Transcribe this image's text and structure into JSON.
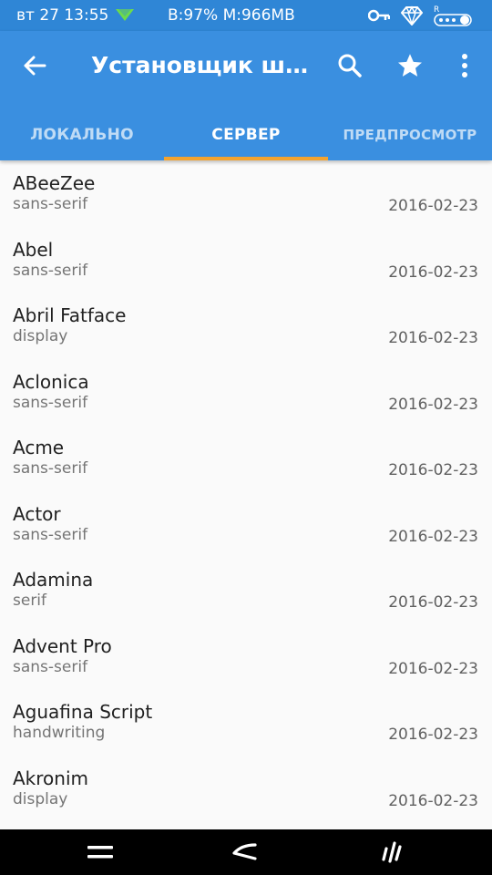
{
  "status_bar": {
    "day_time": "вт 27 13:55",
    "battery_memory": "B:97% M:966MB",
    "icons": [
      "download-arrow-icon",
      "key-icon",
      "diamond-icon",
      "rooted-toggle-icon"
    ]
  },
  "app_bar": {
    "title": "Установщик шрифтов",
    "icons": [
      "back-arrow-icon",
      "search-icon",
      "star-icon",
      "more-vert-icon"
    ]
  },
  "tabs": [
    {
      "label": "ЛОКАЛЬНО",
      "active": false
    },
    {
      "label": "СЕРВЕР",
      "active": true
    },
    {
      "label": "ПРЕДПРОСМОТР",
      "active": false
    }
  ],
  "fonts": [
    {
      "name": "ABeeZee",
      "category": "sans-serif",
      "date": "2016-02-23"
    },
    {
      "name": "Abel",
      "category": "sans-serif",
      "date": "2016-02-23"
    },
    {
      "name": "Abril Fatface",
      "category": "display",
      "date": "2016-02-23"
    },
    {
      "name": "Aclonica",
      "category": "sans-serif",
      "date": "2016-02-23"
    },
    {
      "name": "Acme",
      "category": "sans-serif",
      "date": "2016-02-23"
    },
    {
      "name": "Actor",
      "category": "sans-serif",
      "date": "2016-02-23"
    },
    {
      "name": "Adamina",
      "category": "serif",
      "date": "2016-02-23"
    },
    {
      "name": "Advent Pro",
      "category": "sans-serif",
      "date": "2016-02-23"
    },
    {
      "name": "Aguafina Script",
      "category": "handwriting",
      "date": "2016-02-23"
    },
    {
      "name": "Akronim",
      "category": "display",
      "date": "2016-02-23"
    }
  ],
  "nav_bar": {
    "icons": [
      "menu-icon",
      "back-icon",
      "recents-icon"
    ]
  },
  "colors": {
    "status_bar": "#2f86d6",
    "app_bar": "#3a8fe0",
    "tab_indicator": "#f4a32e",
    "background": "#fafafa",
    "nav_bar": "#000000"
  }
}
